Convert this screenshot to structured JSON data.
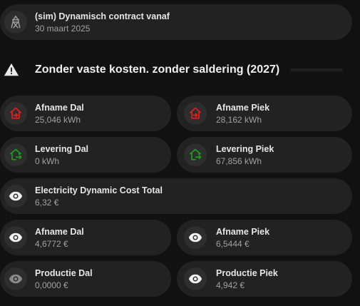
{
  "contract": {
    "title": "(sim) Dynamisch contract vanaf",
    "date": "30 maart 2025",
    "icon": "transmission-tower-icon"
  },
  "section": {
    "title": "Zonder vaste kosten. zonder saldering (2027)",
    "icon": "alert-triangle-icon"
  },
  "cards": {
    "afname_dal_kwh": {
      "title": "Afname Dal",
      "value": "25,046 kWh",
      "icon": "home-import-icon",
      "color": "#e02020"
    },
    "afname_piek_kwh": {
      "title": "Afname Piek",
      "value": "28,162 kWh",
      "icon": "home-import-icon",
      "color": "#e02020"
    },
    "levering_dal": {
      "title": "Levering Dal",
      "value": "0 kWh",
      "icon": "home-export-icon",
      "color": "#19a319"
    },
    "levering_piek": {
      "title": "Levering Piek",
      "value": "67,856 kWh",
      "icon": "home-export-icon",
      "color": "#19a319"
    },
    "total": {
      "title": "Electricity Dynamic Cost Total",
      "value": "6,32 €",
      "icon": "eye-icon"
    },
    "afname_dal_cost": {
      "title": "Afname Dal",
      "value": "4,6772 €",
      "icon": "eye-icon"
    },
    "afname_piek_cost": {
      "title": "Afname Piek",
      "value": "6,5444 €",
      "icon": "eye-icon"
    },
    "productie_dal": {
      "title": "Productie Dal",
      "value": "0,0000 €",
      "icon": "eye-icon"
    },
    "productie_piek": {
      "title": "Productie Piek",
      "value": "4,942 €",
      "icon": "eye-icon"
    }
  }
}
